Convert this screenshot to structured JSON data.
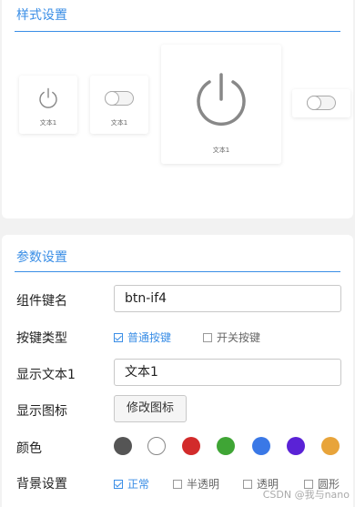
{
  "style_section": {
    "title": "样式设置",
    "previews": [
      {
        "type": "icon",
        "icon": "power-icon",
        "caption": "文本1"
      },
      {
        "type": "switch",
        "icon": "toggle-switch",
        "caption": "文本1"
      },
      {
        "type": "icon",
        "icon": "power-icon",
        "caption": "文本1"
      },
      {
        "type": "switch",
        "icon": "toggle-switch",
        "caption": ""
      }
    ]
  },
  "params_section": {
    "title": "参数设置",
    "component_key": {
      "label": "组件键名",
      "value": "btn-if4"
    },
    "button_type": {
      "label": "按键类型",
      "options": [
        {
          "label": "普通按键",
          "checked": true
        },
        {
          "label": "开关按键",
          "checked": false
        }
      ]
    },
    "display_text": {
      "label": "显示文本1",
      "value": "文本1"
    },
    "display_icon": {
      "label": "显示图标",
      "button": "修改图标"
    },
    "color": {
      "label": "颜色",
      "swatches": [
        "#555555",
        "#ffffff",
        "#d22b2b",
        "#3fa535",
        "#3a78e6",
        "#5a22d6",
        "#e8a43a"
      ]
    },
    "background": {
      "label": "背景设置",
      "options": [
        {
          "label": "正常",
          "checked": true
        },
        {
          "label": "半透明",
          "checked": false
        },
        {
          "label": "透明",
          "checked": false
        },
        {
          "label": "圆形",
          "checked": false
        }
      ]
    }
  },
  "watermark": "CSDN @我与nano"
}
